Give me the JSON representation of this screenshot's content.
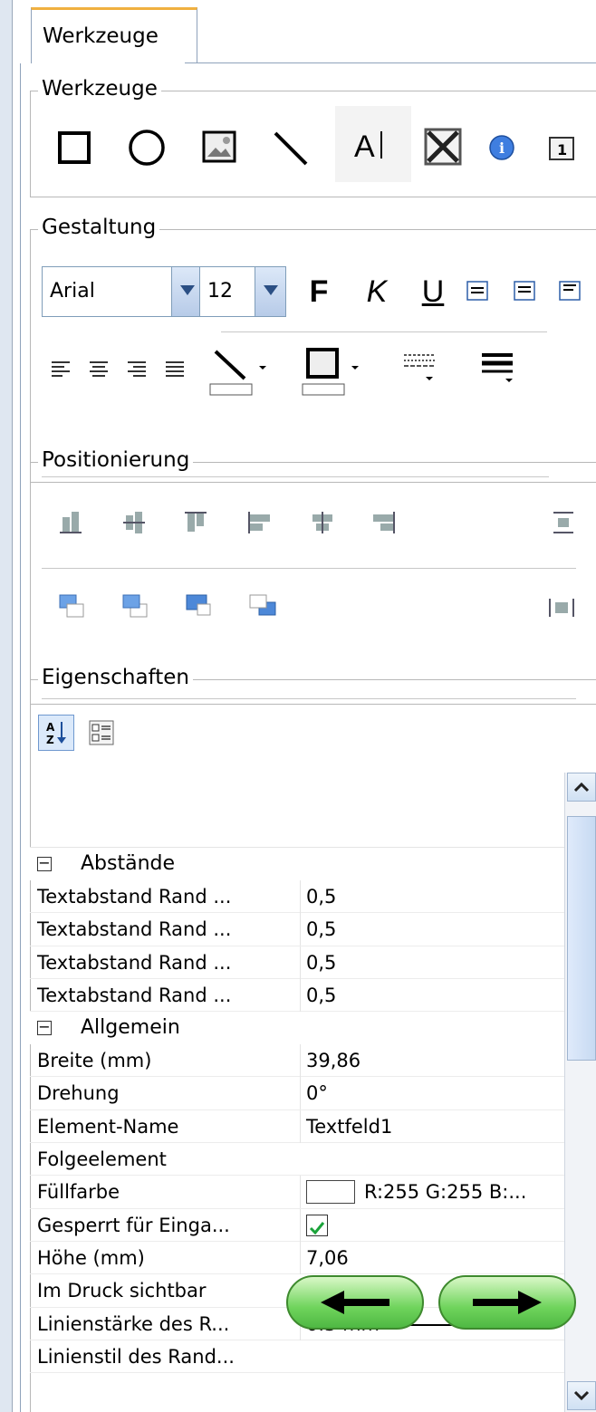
{
  "tab": {
    "label": "Werkzeuge"
  },
  "groups": {
    "werkzeuge": "Werkzeuge",
    "gestaltung": "Gestaltung",
    "positionierung": "Positionierung",
    "eigenschaften": "Eigenschaften"
  },
  "gestaltung": {
    "font": "Arial",
    "size": "12",
    "bold": "F",
    "italic": "K",
    "underline": "U"
  },
  "categories": [
    {
      "label": "Abstände",
      "rows": [
        {
          "key": "Textabstand Rand ...",
          "value": "0,5"
        },
        {
          "key": "Textabstand Rand ...",
          "value": "0,5"
        },
        {
          "key": "Textabstand Rand ...",
          "value": "0,5"
        },
        {
          "key": "Textabstand Rand ...",
          "value": "0,5"
        }
      ]
    },
    {
      "label": "Allgemein",
      "rows": [
        {
          "key": "Breite (mm)",
          "value": "39,86"
        },
        {
          "key": "Drehung",
          "value": "0°"
        },
        {
          "key": "Element-Name",
          "value": "Textfeld1"
        },
        {
          "key": "Folgeelement",
          "value": ""
        },
        {
          "key": "Füllfarbe",
          "value": "R:255 G:255 B:..."
        },
        {
          "key": "Gesperrt für Einga...",
          "value": ""
        },
        {
          "key": "Höhe (mm)",
          "value": "7,06"
        },
        {
          "key": "Im Druck sichtbar",
          "value": ""
        },
        {
          "key": "Linienstärke des R...",
          "value": "0.3 mm"
        },
        {
          "key": "Linienstil des Rand...",
          "value": ""
        }
      ]
    }
  ],
  "colors": {
    "accent": "#f0b040",
    "nav_green": "#6fd45c",
    "border_blue": "#8fa2bb"
  }
}
